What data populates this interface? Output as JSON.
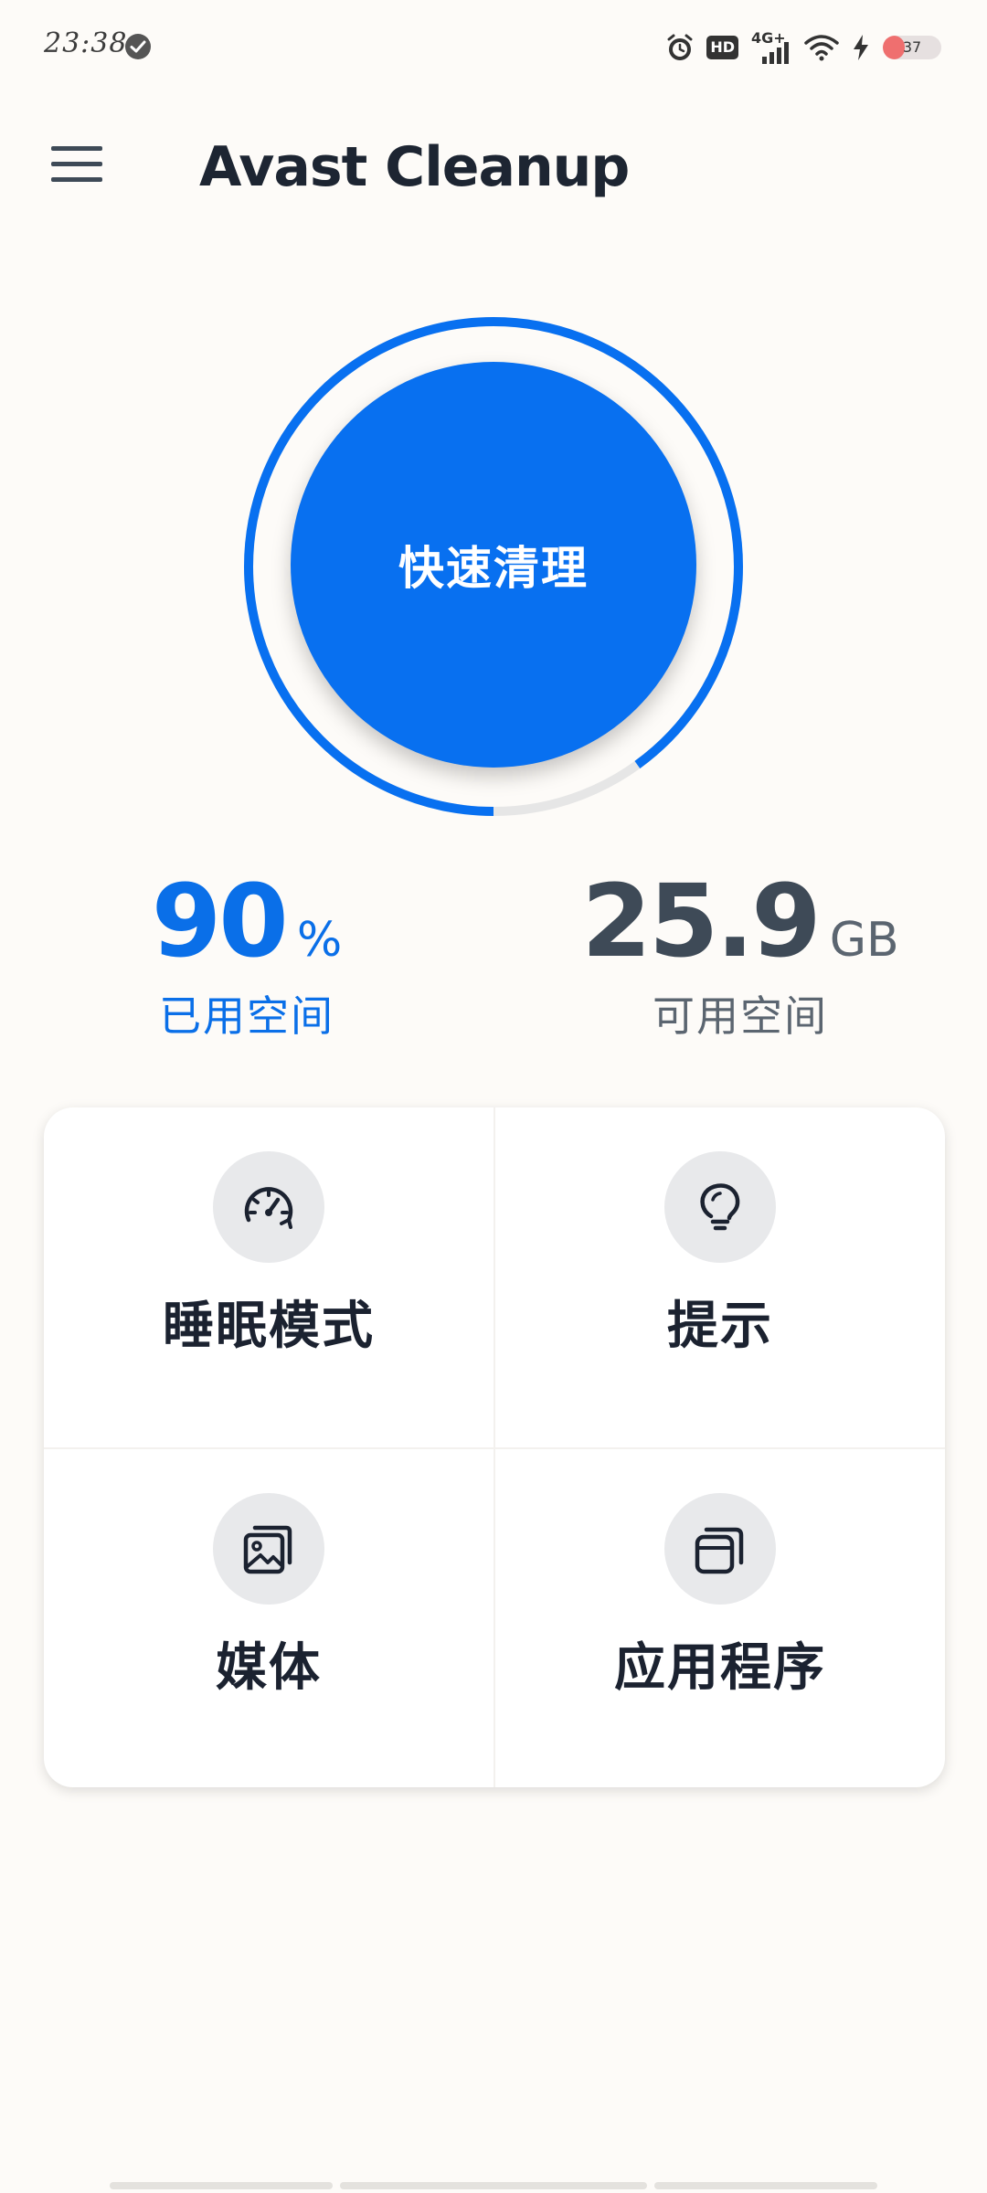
{
  "status_bar": {
    "time": "23:38",
    "network": "4G+",
    "hd": "HD",
    "battery_level": "37",
    "battery_percent": 37
  },
  "app": {
    "title": "Avast Cleanup"
  },
  "storage": {
    "used_fraction": 0.9,
    "used_value": "90",
    "used_unit": "%",
    "used_label": "已用空间",
    "free_value": "25.9",
    "free_unit": "GB",
    "free_label": "可用空间"
  },
  "quick_clean": {
    "label": "快速清理"
  },
  "features": [
    {
      "label": "睡眠模式",
      "icon": "speedometer-icon"
    },
    {
      "label": "提示",
      "icon": "lightbulb-icon"
    },
    {
      "label": "媒体",
      "icon": "media-gallery-icon"
    },
    {
      "label": "应用程序",
      "icon": "apps-stack-icon"
    }
  ],
  "colors": {
    "accent": "#0870f0",
    "ring_track": "#e6e6e6",
    "text_dark": "#1b2230",
    "icon_bg": "#e8e9eb",
    "background": "#fdfbf8"
  }
}
